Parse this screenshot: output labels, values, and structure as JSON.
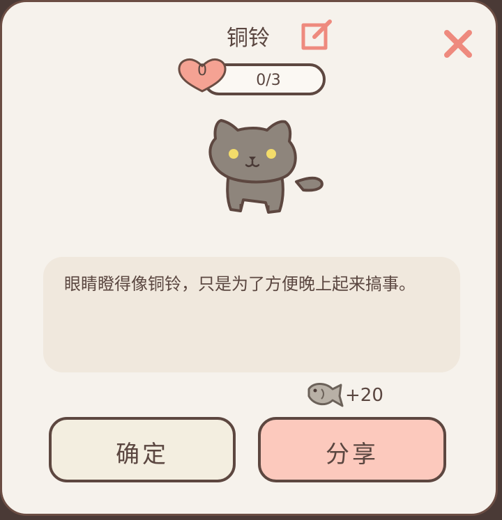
{
  "dialog": {
    "title": "铜铃",
    "heart_count": "0",
    "progress_text": "0/3",
    "progress_value": 0,
    "progress_max": 3,
    "description": "眼睛瞪得像铜铃，只是为了方便晚上起来搞事。",
    "reward_text": "+20",
    "confirm_label": "确定",
    "share_label": "分享"
  },
  "icons": {
    "edit": "edit-icon",
    "close": "close-icon",
    "heart": "heart-icon",
    "fish": "fish-icon",
    "cat": "cat-illustration"
  },
  "colors": {
    "background": "#f6f2ec",
    "border": "#6b4d43",
    "accent": "#ee8a7e",
    "share_button": "#fcc9bd",
    "confirm_button": "#f3eee0",
    "text_box": "#f0e8dd",
    "cat_body": "#8e857c",
    "cat_eyes": "#f3dc6a"
  }
}
